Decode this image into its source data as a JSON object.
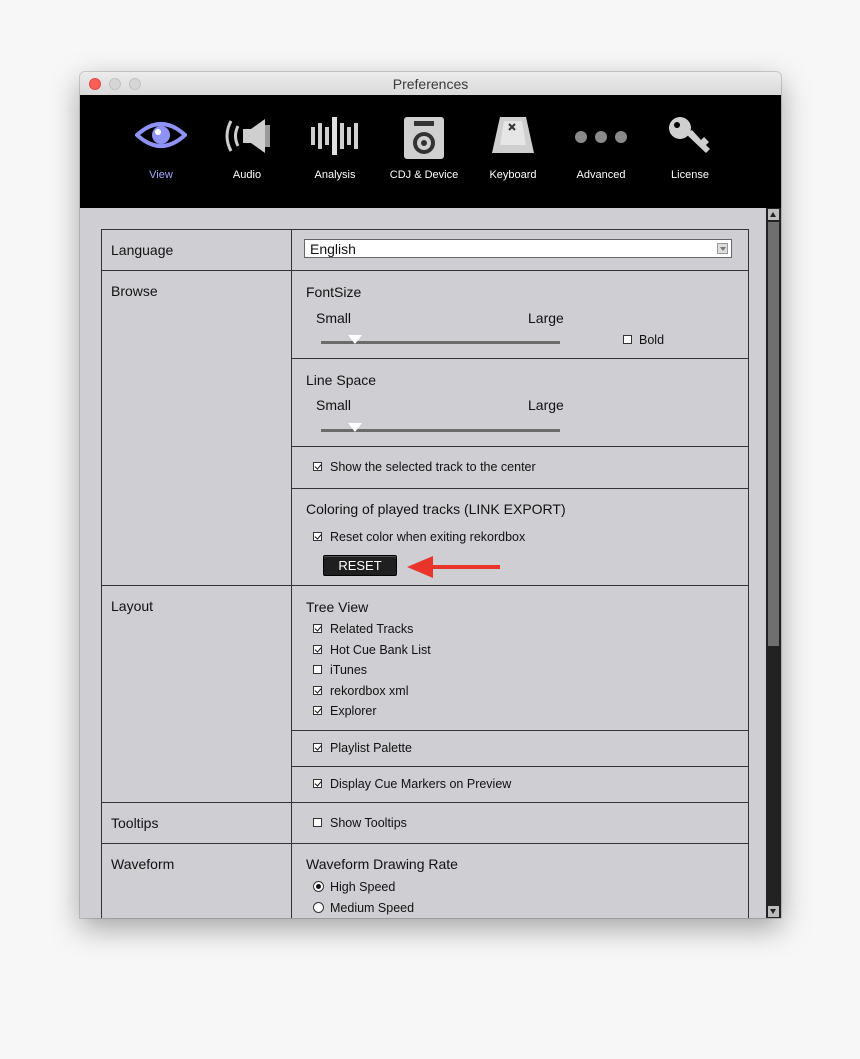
{
  "window": {
    "title": "Preferences"
  },
  "toolbar": {
    "items": [
      {
        "label": "View",
        "icon": "eye-icon",
        "active": true
      },
      {
        "label": "Audio",
        "icon": "speaker-icon"
      },
      {
        "label": "Analysis",
        "icon": "waveform-bars-icon"
      },
      {
        "label": "CDJ & Device",
        "icon": "cdj-device-icon"
      },
      {
        "label": "Keyboard",
        "icon": "keyboard-key-icon"
      },
      {
        "label": "Advanced",
        "icon": "three-dots-icon"
      },
      {
        "label": "License",
        "icon": "key-icon"
      }
    ],
    "active_color": "#a4a8ff"
  },
  "language": {
    "label": "Language",
    "value": "English"
  },
  "browse": {
    "label": "Browse",
    "font_size": {
      "title": "FontSize",
      "min_label": "Small",
      "max_label": "Large",
      "level": 0.15,
      "bold_label": "Bold",
      "bold_checked": false
    },
    "line_space": {
      "title": "Line Space",
      "min_label": "Small",
      "max_label": "Large",
      "level": 0.15
    },
    "center_track": {
      "label": "Show the selected track to the center",
      "checked": true
    },
    "coloring": {
      "title": "Coloring of played tracks  (LINK EXPORT)",
      "reset_on_exit_label": "Reset color when exiting rekordbox",
      "reset_on_exit_checked": true,
      "reset_button": "RESET"
    }
  },
  "layout": {
    "label": "Layout",
    "tree_view": {
      "title": "Tree View",
      "items": [
        {
          "label": "Related Tracks",
          "checked": true
        },
        {
          "label": "Hot Cue Bank List",
          "checked": true
        },
        {
          "label": "iTunes",
          "checked": false
        },
        {
          "label": "rekordbox xml",
          "checked": true
        },
        {
          "label": "Explorer",
          "checked": true
        }
      ]
    },
    "playlist_palette": {
      "label": "Playlist Palette",
      "checked": true
    },
    "cue_markers": {
      "label": "Display Cue Markers on Preview",
      "checked": true
    }
  },
  "tooltips": {
    "label": "Tooltips",
    "show_label": "Show Tooltips",
    "checked": false
  },
  "waveform": {
    "label": "Waveform",
    "title": "Waveform Drawing Rate",
    "options": [
      {
        "label": "High Speed",
        "selected": true
      },
      {
        "label": "Medium Speed",
        "selected": false
      }
    ]
  },
  "colors": {
    "annotation_arrow": "#e8342a"
  }
}
